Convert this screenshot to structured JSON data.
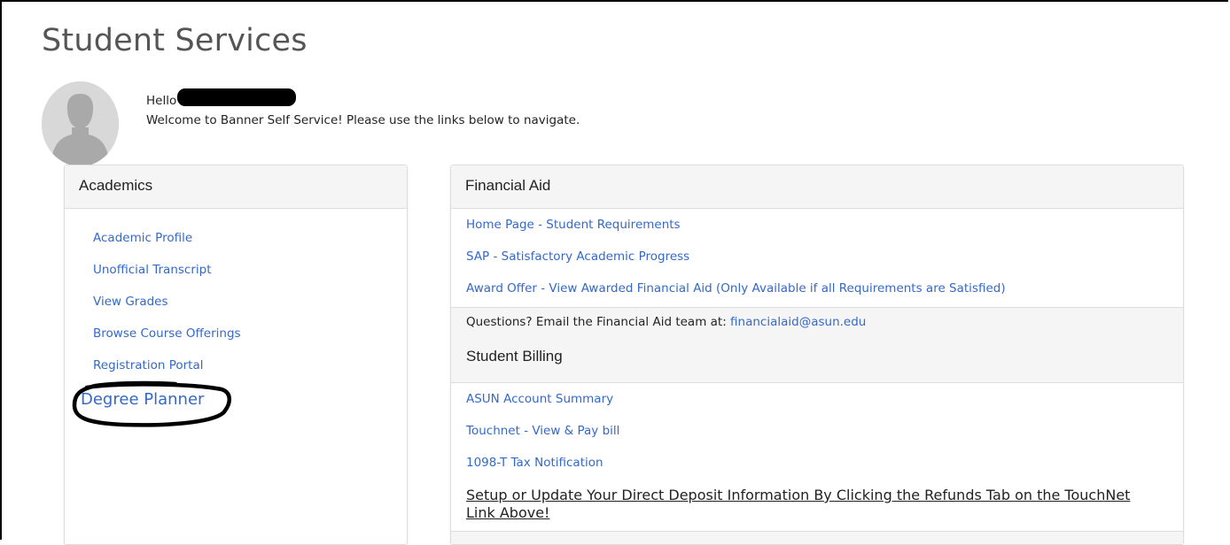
{
  "page": {
    "title": "Student Services"
  },
  "welcome": {
    "hello": "Hello",
    "message": "Welcome to Banner Self Service! Please use the links below to navigate."
  },
  "academics": {
    "title": "Academics",
    "links": [
      "Academic Profile",
      "Unofficial Transcript",
      "View Grades",
      "Browse Course Offerings",
      "Registration Portal"
    ],
    "degree_planner": "Degree Planner"
  },
  "financial_aid": {
    "title": "Financial Aid",
    "links": [
      "Home Page - Student Requirements",
      "SAP - Satisfactory Academic Progress",
      "Award Offer - View Awarded Financial Aid (Only Available if all Requirements are Satisfied)"
    ],
    "questions_text": "Questions? Email the Financial Aid team at:",
    "questions_email": "financialaid@asun.edu"
  },
  "student_billing": {
    "title": "Student Billing",
    "links": [
      "ASUN Account Summary",
      "Touchnet - View & Pay bill",
      "1098-T Tax Notification"
    ],
    "refund_note": "Setup or Update Your Direct Deposit Information By Clicking the Refunds Tab on the TouchNet Link Above!"
  },
  "colors": {
    "link": "#3469c8",
    "panel_header_bg": "#f5f5f5",
    "annotation": "#000000"
  },
  "icons": {
    "avatar": "user-silhouette-icon"
  }
}
